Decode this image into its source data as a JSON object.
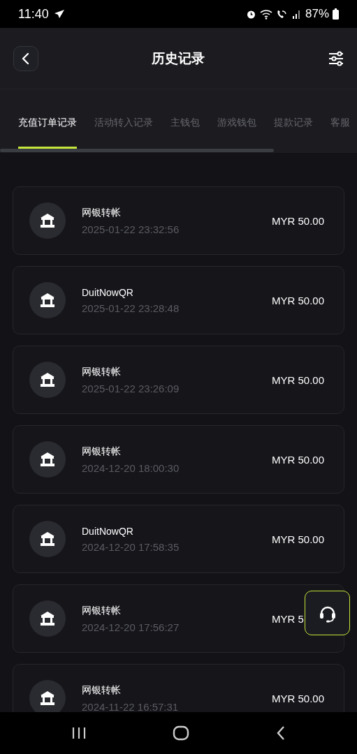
{
  "status_bar": {
    "time": "11:40",
    "battery": "87%"
  },
  "header": {
    "title": "历史记录"
  },
  "tabs": [
    {
      "label": "充值订单记录",
      "selected": true
    },
    {
      "label": "活动转入记录",
      "selected": false
    },
    {
      "label": "主钱包",
      "selected": false
    },
    {
      "label": "游戏钱包",
      "selected": false
    },
    {
      "label": "提款记录",
      "selected": false
    },
    {
      "label": "客服",
      "selected": false
    }
  ],
  "records": [
    {
      "method": "网银转帐",
      "time": "2025-01-22 23:32:56",
      "amount": "MYR 50.00"
    },
    {
      "method": "DuitNowQR",
      "time": "2025-01-22 23:28:48",
      "amount": "MYR 50.00"
    },
    {
      "method": "网银转帐",
      "time": "2025-01-22 23:26:09",
      "amount": "MYR 50.00"
    },
    {
      "method": "网银转帐",
      "time": "2024-12-20 18:00:30",
      "amount": "MYR 50.00"
    },
    {
      "method": "DuitNowQR",
      "time": "2024-12-20 17:58:35",
      "amount": "MYR 50.00"
    },
    {
      "method": "网银转帐",
      "time": "2024-12-20 17:56:27",
      "amount": "MYR 5"
    },
    {
      "method": "网银转帐",
      "time": "2024-11-22 16:57:31",
      "amount": "MYR 50.00"
    }
  ]
}
